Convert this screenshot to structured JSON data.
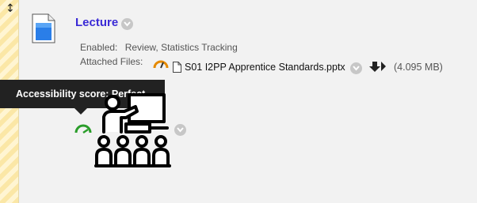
{
  "item": {
    "title": "Lecture",
    "enabled_label": "Enabled:",
    "enabled_value": "Review, Statistics Tracking",
    "attached_label": "Attached Files:",
    "file_name": "S01 I2PP Apprentice Standards.pptx",
    "file_size": "(4.095 MB)"
  },
  "tooltip": {
    "text": "Accessibility score: Perfect"
  },
  "colors": {
    "title": "#3a2ad6",
    "score_perfect": "#2a9d2a",
    "score_medium": "#e58a00",
    "strip": "#fbe7a6"
  },
  "icons": {
    "drag": "move-vertical-icon",
    "item_type": "file-document-icon",
    "menu": "chevron-down-icon",
    "download": "download-icon",
    "accessibility": "gauge-icon",
    "image": "teacher-classroom-icon"
  }
}
